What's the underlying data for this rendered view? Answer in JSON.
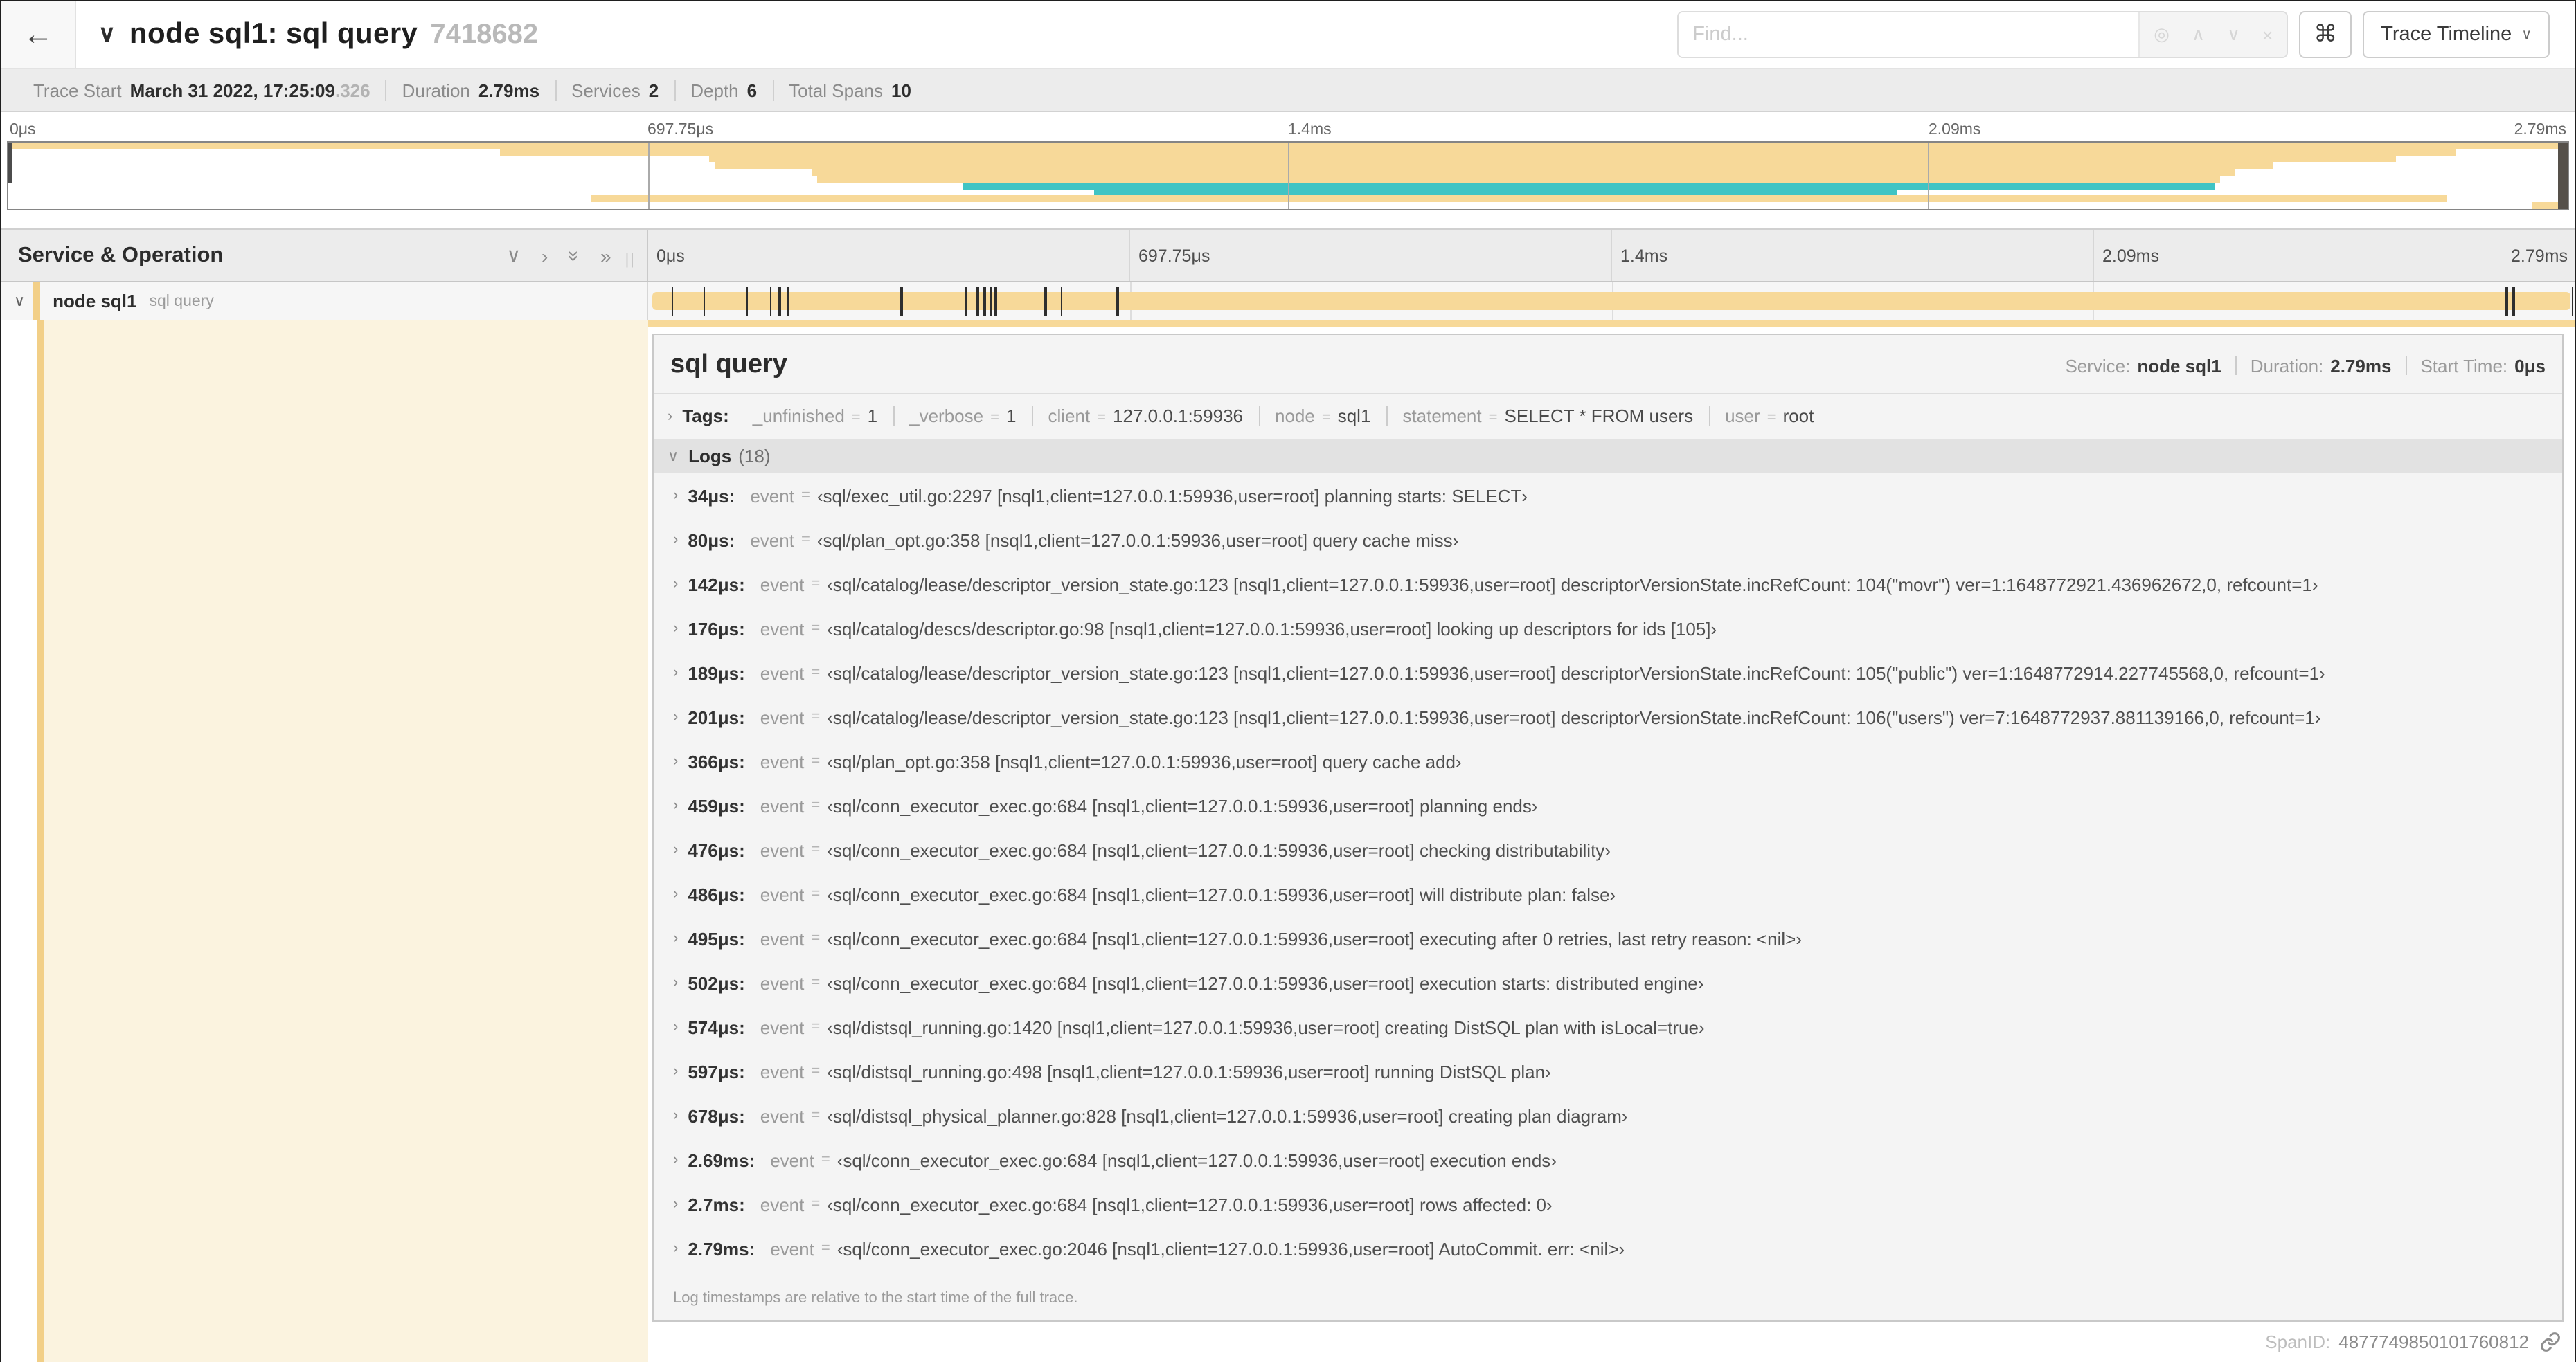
{
  "colors": {
    "span_bar": "#F7D999",
    "span_bar_alt": "#40C4C4",
    "span_stripe": "#F2CF87",
    "detail_col_bg": "#FBF3DF"
  },
  "header": {
    "back_icon": "←",
    "collapse_icon": "∨",
    "title": "node sql1: sql query",
    "trace_id": "7418682",
    "find": {
      "placeholder": "Find...",
      "locate_icon": "◎",
      "prev_icon": "∧",
      "next_icon": "∨",
      "clear_icon": "×"
    },
    "shortcut_icon": "⌘",
    "view_selector": "Trace Timeline",
    "view_caret": "∨"
  },
  "summary": {
    "items": [
      {
        "label": "Trace Start",
        "value": "March 31 2022, 17:25:09",
        "light": ".326"
      },
      {
        "label": "Duration",
        "value": "2.79ms",
        "light": ""
      },
      {
        "label": "Services",
        "value": "2",
        "light": ""
      },
      {
        "label": "Depth",
        "value": "6",
        "light": ""
      },
      {
        "label": "Total Spans",
        "value": "10",
        "light": ""
      }
    ]
  },
  "minimap": {
    "labels": [
      "0μs",
      "697.75μs",
      "1.4ms",
      "2.09ms",
      "2.79ms"
    ],
    "bars": [
      {
        "top": "0%",
        "left": "0%",
        "width": "100%",
        "color": "#F7D999"
      },
      {
        "top": "10%",
        "left": "19.2%",
        "width": "76.4%",
        "color": "#F7D999"
      },
      {
        "top": "20%",
        "left": "27.4%",
        "width": "65.9%",
        "color": "#F7D999"
      },
      {
        "top": "30%",
        "left": "27.6%",
        "width": "60.9%",
        "color": "#F7D999"
      },
      {
        "top": "40%",
        "left": "31.4%",
        "width": "55.6%",
        "color": "#F7D999"
      },
      {
        "top": "50%",
        "left": "31.6%",
        "width": "54.8%",
        "color": "#F7D999"
      },
      {
        "top": "60%",
        "left": "37.3%",
        "width": "48.9%",
        "color": "#40C4C4"
      },
      {
        "top": "70%",
        "left": "42.4%",
        "width": "31.4%",
        "color": "#40C4C4"
      },
      {
        "top": "80%",
        "left": "22.8%",
        "width": "72.5%",
        "color": "#F7D999"
      },
      {
        "top": "90%",
        "left": "98.6%",
        "width": "1.2%",
        "color": "#F7D999"
      }
    ]
  },
  "timeline": {
    "so_header": "Service & Operation",
    "controls": {
      "collapse_one": "∨",
      "expand_one": "›",
      "collapse_all": "»",
      "expand_all": "»",
      "grip": "||"
    },
    "labels": [
      "0μs",
      "697.75μs",
      "1.4ms",
      "2.09ms",
      "2.79ms"
    ]
  },
  "span_row": {
    "expander": "∨",
    "service": "node sql1",
    "operation": "sql query",
    "ticks": [
      {
        "left": "1.22%"
      },
      {
        "left": "2.87%"
      },
      {
        "left": "5.09%"
      },
      {
        "left": "6.31%"
      },
      {
        "left": "6.77%"
      },
      {
        "left": "7.2%"
      },
      {
        "left": "13.12%"
      },
      {
        "left": "16.45%"
      },
      {
        "left": "17.06%"
      },
      {
        "left": "17.42%"
      },
      {
        "left": "17.74%"
      },
      {
        "left": "17.99%"
      },
      {
        "left": "20.57%"
      },
      {
        "left": "21.4%"
      },
      {
        "left": "24.3%"
      },
      {
        "left": "96.42%"
      },
      {
        "left": "96.77%"
      },
      {
        "left": "99.85%"
      }
    ]
  },
  "detail": {
    "title": "sql query",
    "meta": [
      {
        "label": "Service:",
        "value": "node sql1"
      },
      {
        "label": "Duration:",
        "value": "2.79ms"
      },
      {
        "label": "Start Time:",
        "value": "0μs"
      }
    ],
    "tags_expander": "›",
    "tags_label": "Tags:",
    "tags": [
      {
        "key": "_unfinished",
        "value": "1"
      },
      {
        "key": "_verbose",
        "value": "1"
      },
      {
        "key": "client",
        "value": "127.0.0.1:59936"
      },
      {
        "key": "node",
        "value": "sql1"
      },
      {
        "key": "statement",
        "value": "SELECT * FROM users"
      },
      {
        "key": "user",
        "value": "root"
      }
    ],
    "logs_expander": "∨",
    "logs_label": "Logs",
    "logs_count": "(18)",
    "event_key": "event",
    "logs": [
      {
        "t": "34μs:",
        "text": "‹sql/exec_util.go:2297 [nsql1,client=127.0.0.1:59936,user=root] planning starts: SELECT›"
      },
      {
        "t": "80μs:",
        "text": "‹sql/plan_opt.go:358 [nsql1,client=127.0.0.1:59936,user=root] query cache miss›"
      },
      {
        "t": "142μs:",
        "text": "‹sql/catalog/lease/descriptor_version_state.go:123 [nsql1,client=127.0.0.1:59936,user=root] descriptorVersionState.incRefCount: 104(\"movr\") ver=1:1648772921.436962672,0, refcount=1›"
      },
      {
        "t": "176μs:",
        "text": "‹sql/catalog/descs/descriptor.go:98 [nsql1,client=127.0.0.1:59936,user=root] looking up descriptors for ids [105]›"
      },
      {
        "t": "189μs:",
        "text": "‹sql/catalog/lease/descriptor_version_state.go:123 [nsql1,client=127.0.0.1:59936,user=root] descriptorVersionState.incRefCount: 105(\"public\") ver=1:1648772914.227745568,0, refcount=1›"
      },
      {
        "t": "201μs:",
        "text": "‹sql/catalog/lease/descriptor_version_state.go:123 [nsql1,client=127.0.0.1:59936,user=root] descriptorVersionState.incRefCount: 106(\"users\") ver=7:1648772937.881139166,0, refcount=1›"
      },
      {
        "t": "366μs:",
        "text": "‹sql/plan_opt.go:358 [nsql1,client=127.0.0.1:59936,user=root] query cache add›"
      },
      {
        "t": "459μs:",
        "text": "‹sql/conn_executor_exec.go:684 [nsql1,client=127.0.0.1:59936,user=root] planning ends›"
      },
      {
        "t": "476μs:",
        "text": "‹sql/conn_executor_exec.go:684 [nsql1,client=127.0.0.1:59936,user=root] checking distributability›"
      },
      {
        "t": "486μs:",
        "text": "‹sql/conn_executor_exec.go:684 [nsql1,client=127.0.0.1:59936,user=root] will distribute plan: false›"
      },
      {
        "t": "495μs:",
        "text": "‹sql/conn_executor_exec.go:684 [nsql1,client=127.0.0.1:59936,user=root] executing after 0 retries, last retry reason: <nil>›"
      },
      {
        "t": "502μs:",
        "text": "‹sql/conn_executor_exec.go:684 [nsql1,client=127.0.0.1:59936,user=root] execution starts: distributed engine›"
      },
      {
        "t": "574μs:",
        "text": "‹sql/distsql_running.go:1420 [nsql1,client=127.0.0.1:59936,user=root] creating DistSQL plan with isLocal=true›"
      },
      {
        "t": "597μs:",
        "text": "‹sql/distsql_running.go:498 [nsql1,client=127.0.0.1:59936,user=root] running DistSQL plan›"
      },
      {
        "t": "678μs:",
        "text": "‹sql/distsql_physical_planner.go:828 [nsql1,client=127.0.0.1:59936,user=root] creating plan diagram›"
      },
      {
        "t": "2.69ms:",
        "text": "‹sql/conn_executor_exec.go:684 [nsql1,client=127.0.0.1:59936,user=root] execution ends›"
      },
      {
        "t": "2.7ms:",
        "text": "‹sql/conn_executor_exec.go:684 [nsql1,client=127.0.0.1:59936,user=root] rows affected: 0›"
      },
      {
        "t": "2.79ms:",
        "text": "‹sql/conn_executor_exec.go:2046 [nsql1,client=127.0.0.1:59936,user=root] AutoCommit. err: <nil>›"
      }
    ],
    "footer_note": "Log timestamps are relative to the start time of the full trace."
  },
  "footer": {
    "spanid_label": "SpanID:",
    "spanid_value": "4877749850101760812"
  }
}
